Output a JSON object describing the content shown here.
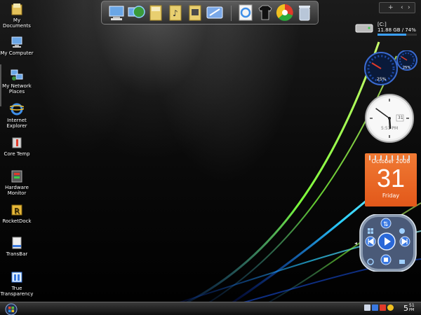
{
  "desktop": {
    "icons": [
      {
        "label": "My Documents",
        "icon": "folder-icon"
      },
      {
        "label": "My Computer",
        "icon": "computer-icon"
      },
      {
        "label": "My Network Places",
        "icon": "network-icon"
      },
      {
        "label": "Internet Explorer",
        "icon": "ie-icon"
      },
      {
        "label": "Core Temp",
        "icon": "core-temp-icon"
      },
      {
        "label": "Hardware Monitor",
        "icon": "hardware-monitor-icon"
      },
      {
        "label": "RocketDock",
        "icon": "rocketdock-icon"
      },
      {
        "label": "TransBar",
        "icon": "transbar-icon"
      },
      {
        "label": "True Transparency",
        "icon": "true-transparency-icon"
      }
    ]
  },
  "dock": {
    "items": [
      "my-computer-icon",
      "network-globe-icon",
      "folder-icon",
      "music-folder-icon",
      "pictures-folder-icon",
      "desktop-shortcut-icon",
      "ie-document-icon",
      "tshirt-icon",
      "color-wheel-icon",
      "recycle-bin-icon"
    ]
  },
  "sidebar": {
    "controls": {
      "add": "+",
      "prev": "‹",
      "next": "›"
    },
    "drive": {
      "name": "[C:]",
      "usage": "11.88 GB / 74%",
      "used_fraction": 0.74
    },
    "meters": {
      "cpu_percent": "25%",
      "mem_percent": "25%"
    },
    "clock": {
      "time_text": "5:51 PM",
      "date_num": "31",
      "hour": 5,
      "minute": 51
    },
    "calendar": {
      "month_year": "October 2008",
      "day": "31",
      "weekday": "Friday"
    }
  },
  "taskbar": {
    "clock_hour": "5",
    "clock_minutes": "51",
    "clock_ampm": "PM"
  },
  "colors": {
    "accent_orange": "#e8651f",
    "accent_blue": "#3aa0ff",
    "wave_green": "#7cff3a",
    "wave_cyan": "#2ad0ff"
  }
}
